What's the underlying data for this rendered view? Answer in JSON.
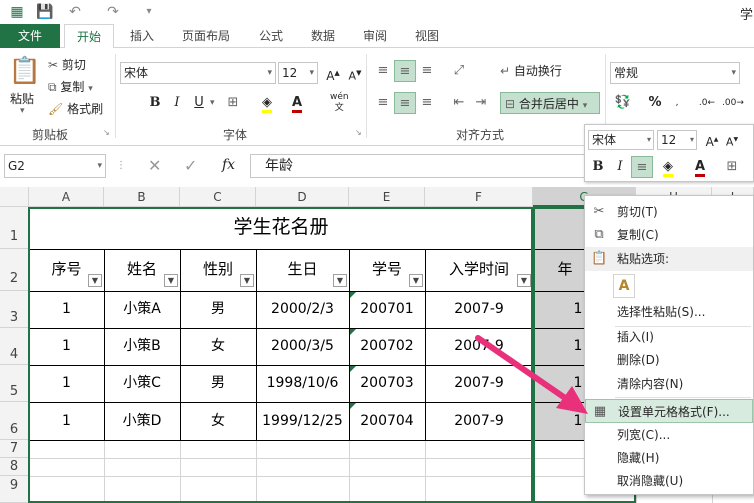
{
  "app": {
    "title_fragment": "学",
    "accent": "#217346"
  },
  "tabs": [
    "文件",
    "开始",
    "插入",
    "页面布局",
    "公式",
    "数据",
    "审阅",
    "视图"
  ],
  "ribbon": {
    "clipboard": {
      "paste": "粘贴",
      "cut": "剪切",
      "copy": "复制",
      "format_painter": "格式刷",
      "group": "剪贴板"
    },
    "font": {
      "name": "宋体",
      "size": "12",
      "bold": "B",
      "italic": "I",
      "underline": "U",
      "phonetic": "wén",
      "group": "字体"
    },
    "alignment": {
      "wrap": "自动换行",
      "merge": "合并后居中",
      "group": "对齐方式"
    },
    "number": {
      "format": "常规",
      "percent": "%"
    }
  },
  "formula_bar": {
    "name_box": "G2",
    "fx": "fx",
    "content": "年龄"
  },
  "columns": [
    "A",
    "B",
    "C",
    "D",
    "E",
    "F",
    "G",
    "H",
    "I"
  ],
  "rows": [
    "1",
    "2",
    "3",
    "4",
    "5",
    "6",
    "7",
    "8",
    "9"
  ],
  "sheet": {
    "title": "学生花名册",
    "headers": [
      "序号",
      "姓名",
      "性别",
      "生日",
      "学号",
      "入学时间",
      "年"
    ],
    "records": [
      [
        "1",
        "小策A",
        "男",
        "2000/2/3",
        "200701",
        "2007-9",
        "1"
      ],
      [
        "1",
        "小策B",
        "女",
        "2000/3/5",
        "200702",
        "2007-9",
        "1"
      ],
      [
        "1",
        "小策C",
        "男",
        "1998/10/6",
        "200703",
        "2007-9",
        "1"
      ],
      [
        "1",
        "小策D",
        "女",
        "1999/12/25",
        "200704",
        "2007-9",
        "1"
      ]
    ]
  },
  "mini_toolbar": {
    "font": "宋体",
    "size": "12",
    "bold": "B",
    "italic": "I"
  },
  "context_menu": {
    "items": [
      {
        "label": "剪切(T)",
        "icon": "scissors-icon"
      },
      {
        "label": "复制(C)",
        "icon": "copy-icon"
      },
      {
        "label": "粘贴选项:",
        "icon": "paste-icon"
      },
      {
        "label": "选择性粘贴(S)...",
        "icon": ""
      },
      {
        "label": "插入(I)",
        "icon": ""
      },
      {
        "label": "删除(D)",
        "icon": ""
      },
      {
        "label": "清除内容(N)",
        "icon": ""
      },
      {
        "label": "设置单元格格式(F)...",
        "icon": "format-cells-icon"
      },
      {
        "label": "列宽(C)...",
        "icon": ""
      },
      {
        "label": "隐藏(H)",
        "icon": ""
      },
      {
        "label": "取消隐藏(U)",
        "icon": ""
      }
    ]
  }
}
